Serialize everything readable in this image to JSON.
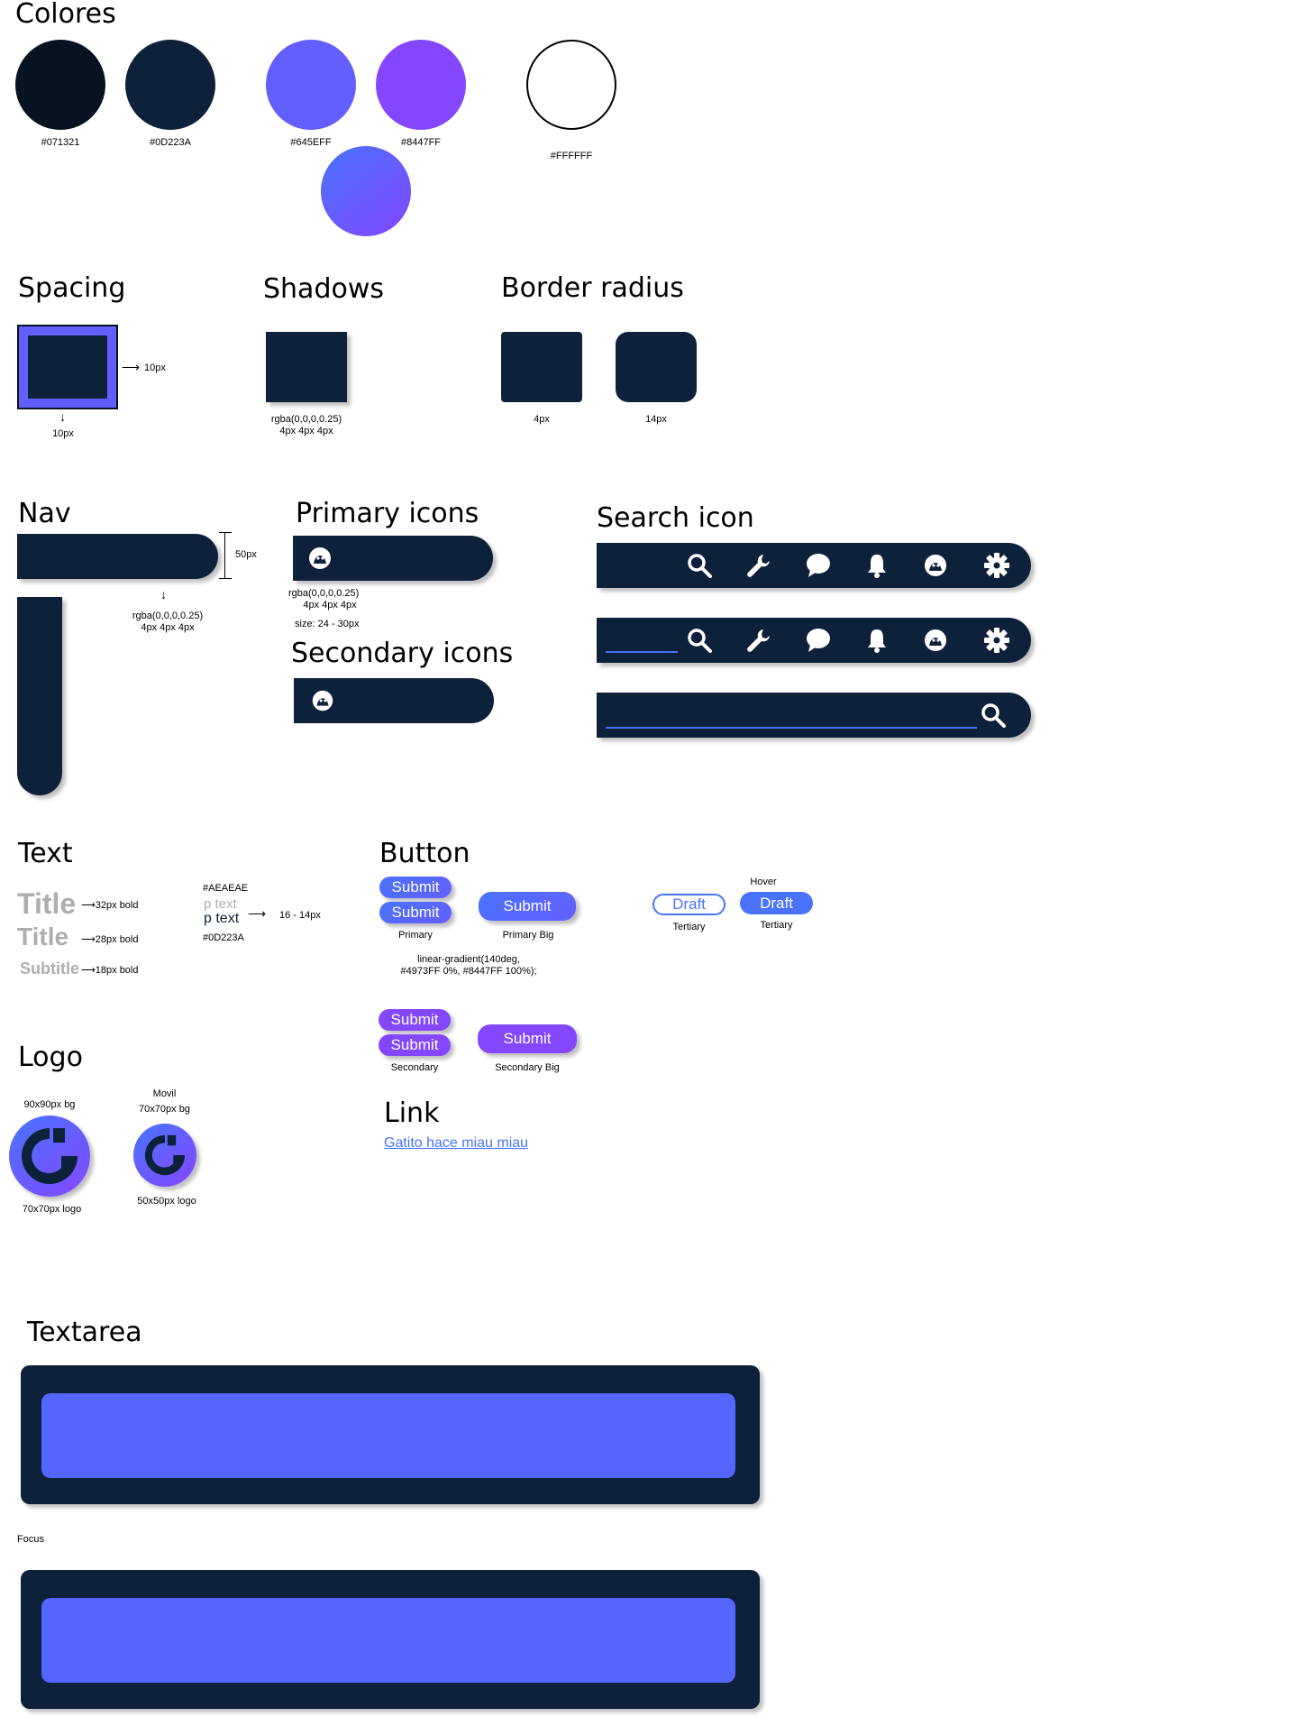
{
  "sections": {
    "colors": "Colores",
    "spacing": "Spacing",
    "shadows": "Shadows",
    "border_radius": "Border radius",
    "nav": "Nav",
    "primary_icons": "Primary icons",
    "secondary_icons": "Secondary icons",
    "search_icon": "Search icon",
    "text": "Text",
    "button": "Button",
    "logo": "Logo",
    "link": "Link",
    "textarea": "Textarea"
  },
  "colors": {
    "swatch_1": "#071321",
    "swatch_2": "#0D223A",
    "swatch_3": "#645EFF",
    "swatch_4": "#8447FF",
    "swatch_5": "#FFFFFF",
    "gradient_start": "#4973FF",
    "gradient_end": "#8447FF",
    "underline": "#4973FF",
    "link": "#4973FF"
  },
  "spacing": {
    "right_label": "10px",
    "bottom_label": "10px"
  },
  "shadows": {
    "line_1": "rgba(0,0,0,0.25)",
    "line_2": "4px 4px 4px"
  },
  "border_radius": {
    "small": "4px",
    "large": "14px"
  },
  "nav": {
    "height_label": "50px",
    "shadow_line_1": "rgba(0,0,0,0.25)",
    "shadow_line_2": "4px 4px 4px"
  },
  "primary_icons": {
    "shadow_line_1": "rgba(0,0,0,0.25)",
    "shadow_line_2": "4px 4px 4px",
    "size": "size: 24 - 30px"
  },
  "text_spec": {
    "title_1": "Title",
    "title_1_note": "32px bold",
    "title_2": "Title",
    "title_2_note": "28px bold",
    "subtitle": "Subtitle",
    "subtitle_note": "18px bold",
    "p_color_light": "#AEAEAE",
    "p_light": "p text",
    "p_dark": "p text",
    "p_color_dark": "#0D223A",
    "p_size": "16 - 14px"
  },
  "buttons": {
    "submit": "Submit",
    "primary_label": "Primary",
    "primary_big_label": "Primary Big",
    "gradient_line_1": "linear-gradient(140deg,",
    "gradient_line_2": "#4973FF 0%, #8447FF 100%);",
    "secondary_label": "Secondary",
    "secondary_big_label": "Secondary Big",
    "draft": "Draft",
    "tertiary_label": "Tertiary",
    "hover_label": "Hover"
  },
  "logo": {
    "big_bg": "90x90px bg",
    "big_logo": "70x70px logo",
    "mobile": "Movil",
    "small_bg": "70x70px bg",
    "small_logo": "50x50px logo"
  },
  "link": {
    "text": "Gatito hace miau miau"
  },
  "textarea": {
    "focus_label": "Focus"
  }
}
